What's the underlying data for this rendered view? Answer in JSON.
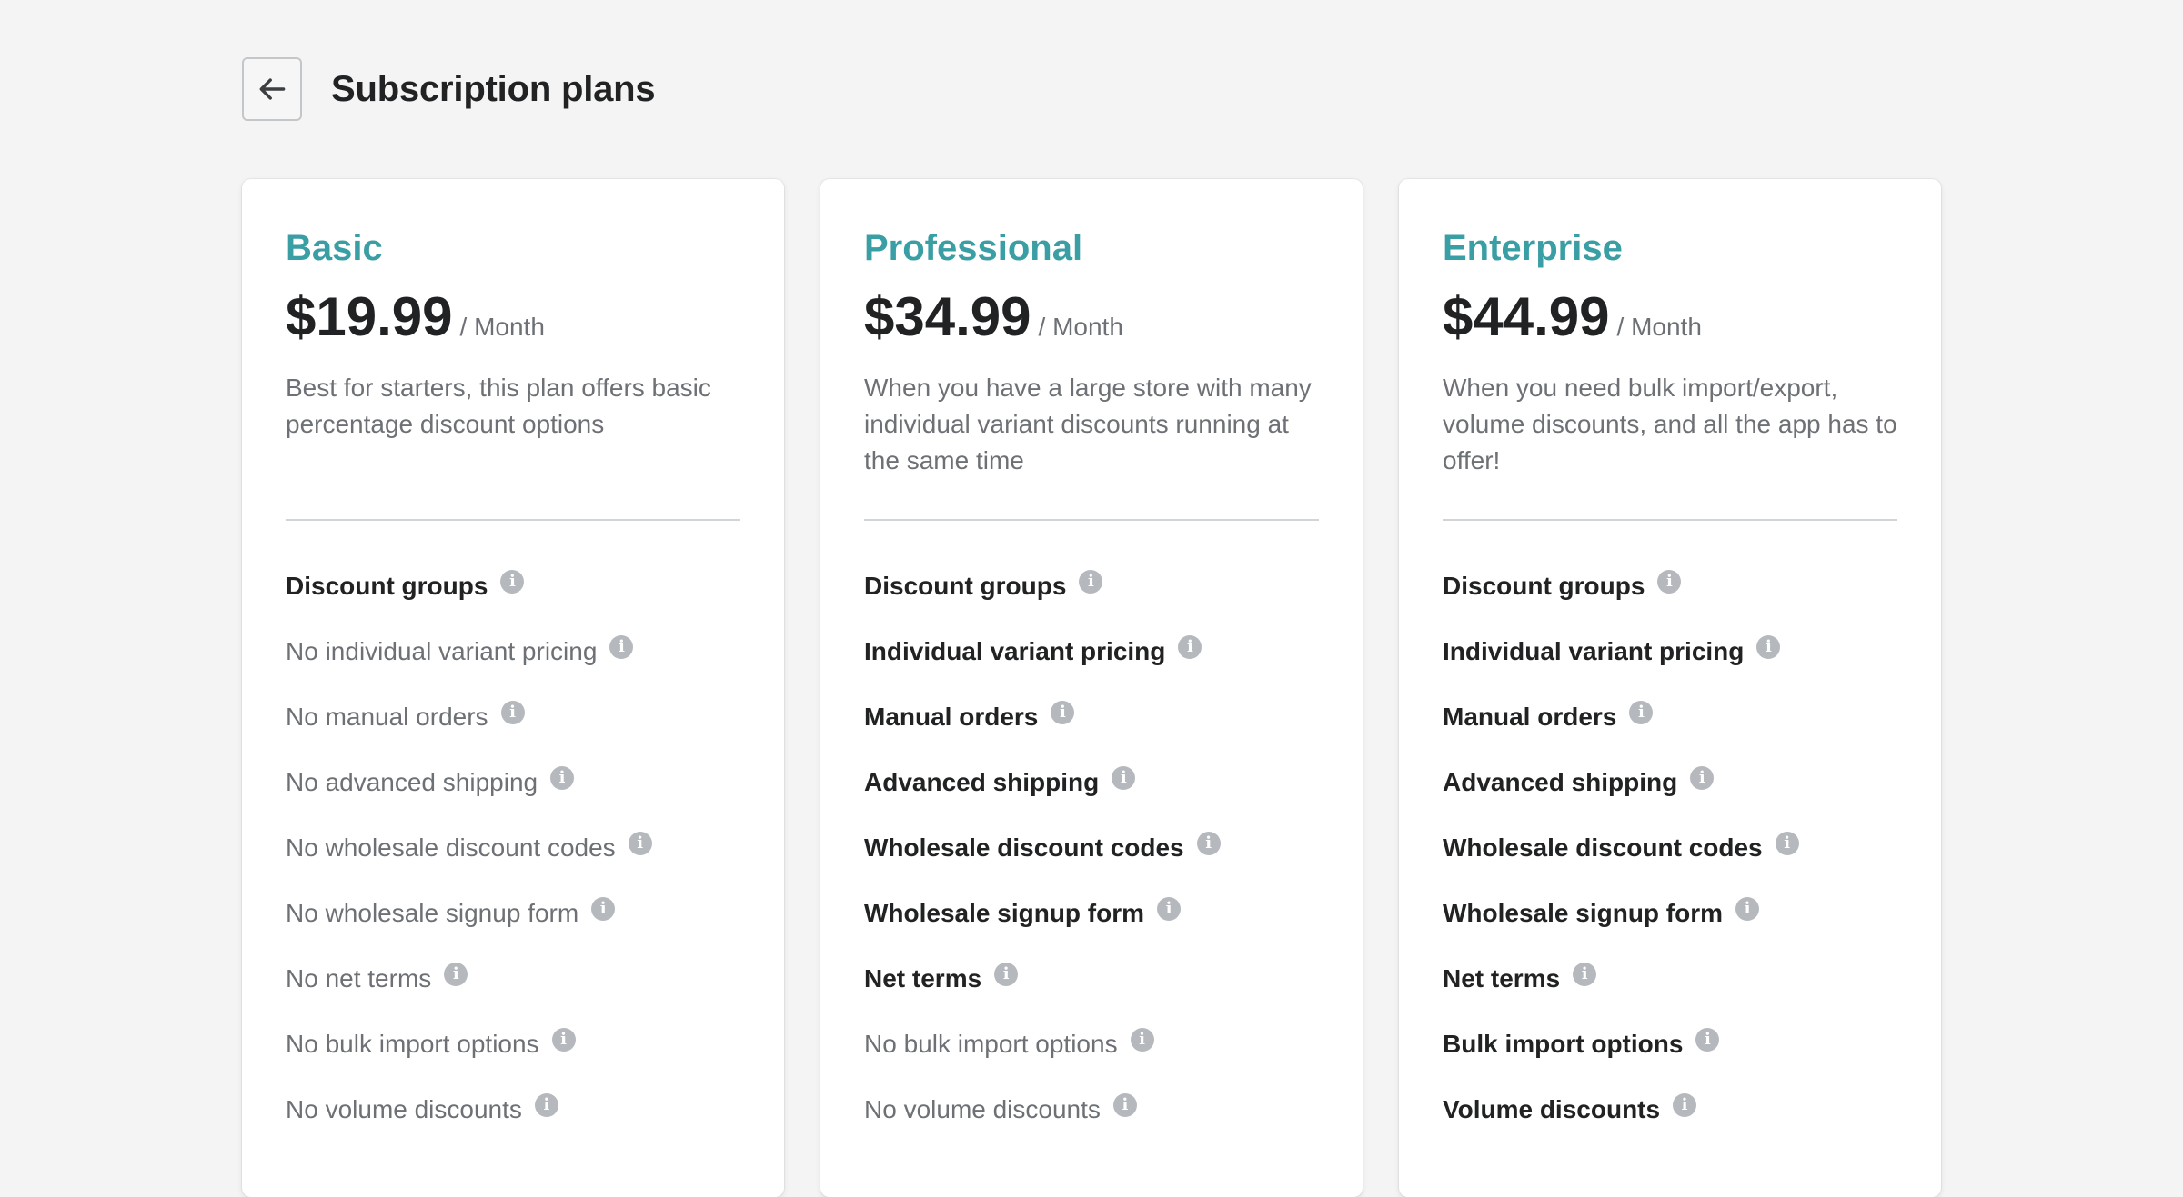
{
  "page": {
    "title": "Subscription plans",
    "back_icon": "arrow-left-icon"
  },
  "colors": {
    "accent": "#3a9ea5",
    "background": "#f4f4f4",
    "text_primary": "#202223",
    "text_muted": "#6d7175",
    "info_icon": "#b5b9bd"
  },
  "plans": [
    {
      "name": "Basic",
      "price": "$19.99",
      "period": "/ Month",
      "description": "Best for starters, this plan offers basic percentage discount options",
      "features": [
        {
          "label": "Discount groups",
          "included": true
        },
        {
          "label": "No individual variant pricing",
          "included": false
        },
        {
          "label": "No manual orders",
          "included": false
        },
        {
          "label": "No advanced shipping",
          "included": false
        },
        {
          "label": "No wholesale discount codes",
          "included": false
        },
        {
          "label": "No wholesale signup form",
          "included": false
        },
        {
          "label": "No net terms",
          "included": false
        },
        {
          "label": "No bulk import options",
          "included": false
        },
        {
          "label": "No volume discounts",
          "included": false
        }
      ]
    },
    {
      "name": "Professional",
      "price": "$34.99",
      "period": "/ Month",
      "description": "When you have a large store with many individual variant discounts running at the same time",
      "features": [
        {
          "label": "Discount groups",
          "included": true
        },
        {
          "label": "Individual variant pricing",
          "included": true
        },
        {
          "label": "Manual orders",
          "included": true
        },
        {
          "label": "Advanced shipping",
          "included": true
        },
        {
          "label": "Wholesale discount codes",
          "included": true
        },
        {
          "label": "Wholesale signup form",
          "included": true
        },
        {
          "label": "Net terms",
          "included": true
        },
        {
          "label": "No bulk import options",
          "included": false
        },
        {
          "label": "No volume discounts",
          "included": false
        }
      ]
    },
    {
      "name": "Enterprise",
      "price": "$44.99",
      "period": "/ Month",
      "description": "When you need bulk import/export, volume discounts, and all the app has to offer!",
      "features": [
        {
          "label": "Discount groups",
          "included": true
        },
        {
          "label": "Individual variant pricing",
          "included": true
        },
        {
          "label": "Manual orders",
          "included": true
        },
        {
          "label": "Advanced shipping",
          "included": true
        },
        {
          "label": "Wholesale discount codes",
          "included": true
        },
        {
          "label": "Wholesale signup form",
          "included": true
        },
        {
          "label": "Net terms",
          "included": true
        },
        {
          "label": "Bulk import options",
          "included": true
        },
        {
          "label": "Volume discounts",
          "included": true
        }
      ]
    }
  ]
}
